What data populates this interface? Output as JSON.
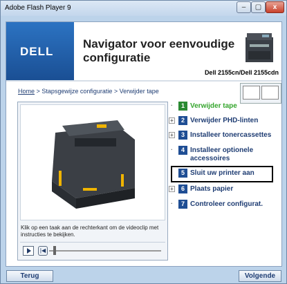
{
  "window": {
    "title": "Adobe Flash Player 9",
    "controls": {
      "minimize": "–",
      "maximize": "▢",
      "close": "x"
    }
  },
  "header": {
    "logo": "DELL",
    "title_line1": "Navigator voor eenvoudige",
    "title_line2": "configuratie",
    "model": "Dell 2155cn/Dell 2155cdn"
  },
  "breadcrumb": {
    "home": "Home",
    "sep1": ">",
    "step": "Stapsgewijze configuratie",
    "sep2": ">",
    "current": "Verwijder tape"
  },
  "video": {
    "hint": "Klik op een taak aan de rechterkant om de videoclip met instructies te bekijken."
  },
  "steps": [
    {
      "num": "1",
      "label": "Verwijder tape",
      "mark": "·",
      "active": true
    },
    {
      "num": "2",
      "label": "Verwijder PHD-linten",
      "mark": "+",
      "active": false
    },
    {
      "num": "3",
      "label": "Installeer tonercassettes",
      "mark": "+",
      "active": false
    },
    {
      "num": "4",
      "label": "Installeer optionele accessoires",
      "mark": "·",
      "active": false
    },
    {
      "num": "5",
      "label": "Sluit uw printer aan",
      "mark": "",
      "active": false
    },
    {
      "num": "6",
      "label": "Plaats papier",
      "mark": "+",
      "active": false
    },
    {
      "num": "7",
      "label": "Controleer configurat.",
      "mark": "·",
      "active": false
    }
  ],
  "footer": {
    "back": "Terug",
    "next": "Volgende"
  },
  "colors": {
    "accent": "#1f4e94",
    "active": "#34a52c"
  }
}
